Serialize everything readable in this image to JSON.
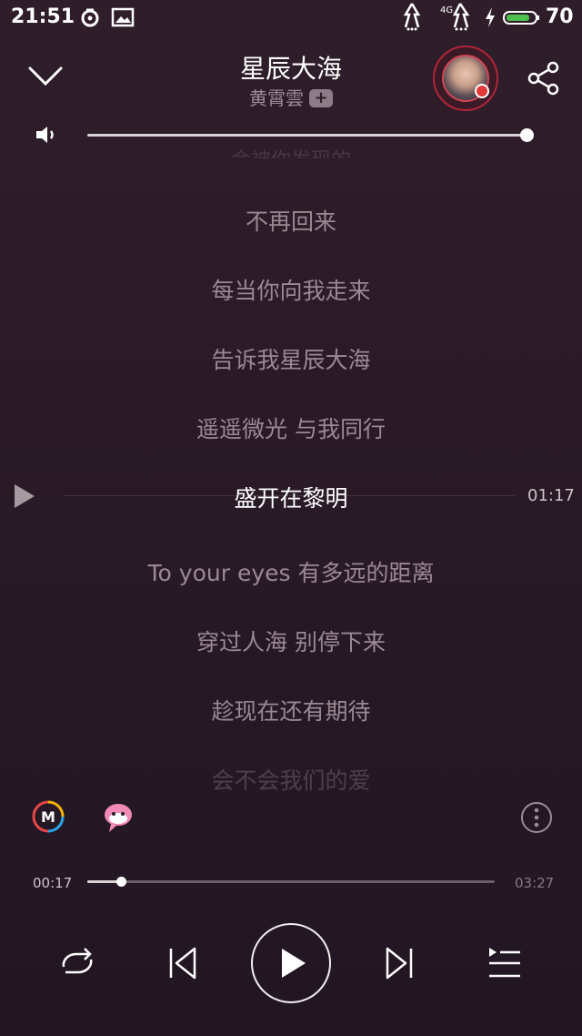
{
  "status_bar": {
    "time": "21:51",
    "battery_level": "70"
  },
  "header": {
    "collapse_icon": "chevron-down-icon",
    "song_title": "星辰大海",
    "artist": "黄霄雲",
    "follow_badge": "+",
    "share_icon": "share-icon"
  },
  "volume": {
    "icon": "speaker-icon",
    "level": 1.0
  },
  "lyrics": {
    "lines": [
      "会被你发现的",
      "不再回来",
      "每当你向我走来",
      "告诉我星辰大海",
      "遥遥微光 与我同行",
      "盛开在黎明",
      "To your eyes 有多远的距离",
      "穿过人海 别停下来",
      "趁现在还有期待",
      "会不会我们的爱"
    ],
    "current_index": 5,
    "current_time": "01:17"
  },
  "tools": {
    "m_icon": "m-logo-icon",
    "mascot_icon": "pink-mascot-icon",
    "more_icon": "more-vertical-icon"
  },
  "progress": {
    "elapsed": "00:17",
    "total": "03:27",
    "fraction": 0.082
  },
  "controls": {
    "repeat_icon": "repeat-icon",
    "prev_icon": "skip-previous-icon",
    "play_icon": "play-icon",
    "next_icon": "skip-next-icon",
    "playlist_icon": "playlist-icon"
  },
  "colors": {
    "accent_red": "#e33a3a",
    "text_dim": "#9a8993"
  }
}
